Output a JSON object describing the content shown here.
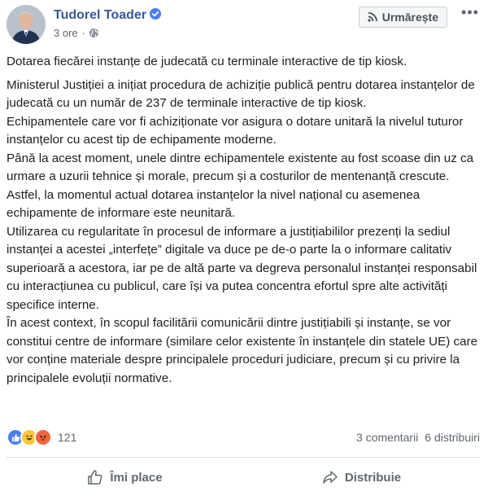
{
  "post": {
    "author": "Tudorel Toader",
    "time": "3 ore",
    "separator": "·",
    "follow_label": "Urmărește",
    "more_label": "•••",
    "headline": "Dotarea fiecărei instanțe de judecată cu terminale interactive de tip kiosk.",
    "body": "Ministerul Justiției a inițiat procedura de achiziție publică pentru dotarea instanțelor de judecată cu un număr de 237 de terminale interactive de tip kiosk.\nEchipamentele care vor fi achiziționate vor asigura o dotare unitară la nivelul tuturor instanțelor cu acest tip de echipamente moderne.\nPână la acest moment, unele dintre echipamentele existente au fost scoase din uz ca urmare a uzurii tehnice și morale, precum și a costurilor de mentenanță crescute. Astfel, la momentul actual dotarea instanțelor la nivel național cu asemenea echipamente de informare este neunitară.\nUtilizarea cu regularitate în procesul de informare a justițiabililor prezenți la sediul instanței a acestei „interfețe” digitale va duce pe de-o parte la o informare calitativ superioară a acestora, iar pe de altă parte va degreva personalul instanței responsabil cu interacțiunea cu publicul, care își va putea concentra efortul spre alte activități specifice interne.\nÎn acest context, în scopul facilitării comunicării dintre justițiabili și instanțe, se vor constitui centre de informare (similare celor existente în instanțele din statele UE) care vor conține materiale despre principalele proceduri judiciare, precum și cu privire la principalele evoluții normative."
  },
  "reactions": {
    "count": "121",
    "icons": [
      "like-reaction-icon",
      "haha-reaction-icon",
      "angry-reaction-icon"
    ],
    "comments": "3 comentarii",
    "shares": "6 distribuiri"
  },
  "actions": {
    "like_label": "Îmi place",
    "share_label": "Distribuie"
  },
  "colors": {
    "author": "#385898",
    "text": "#1c1e21",
    "muted": "#606770",
    "verified": "#4a7ef6"
  }
}
